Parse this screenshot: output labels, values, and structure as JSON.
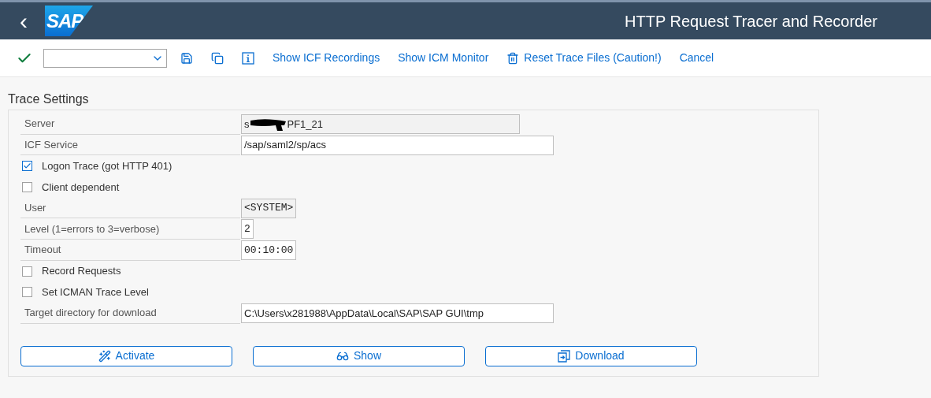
{
  "header": {
    "back": "‹",
    "logo": "SAP",
    "title": "HTTP Request Tracer and Recorder"
  },
  "toolbar": {
    "actions": [
      {
        "label": "Show ICF Recordings"
      },
      {
        "label": "Show ICM Monitor"
      },
      {
        "label": "Reset Trace Files (Caution!)"
      },
      {
        "label": "Cancel"
      }
    ]
  },
  "section": {
    "title": "Trace Settings",
    "rows": [
      {
        "kind": "field",
        "label": "Server",
        "value": "s",
        "value_after_redaction": "PF1_21",
        "readonly": true
      },
      {
        "kind": "field",
        "label": "ICF Service",
        "value": "/sap/saml2/sp/acs",
        "readonly": false
      },
      {
        "kind": "checkbox",
        "label": "Logon Trace (got HTTP 401)",
        "checked": true
      },
      {
        "kind": "checkbox",
        "label": "Client dependent",
        "checked": false
      },
      {
        "kind": "mono_field",
        "label": "User",
        "value": "<SYSTEM>",
        "readonly": true
      },
      {
        "kind": "mono_field",
        "label": "Level (1=errors to 3=verbose)",
        "value": "2",
        "readonly": false
      },
      {
        "kind": "mono_field",
        "label": "Timeout",
        "value": "00:10:00",
        "readonly": false
      },
      {
        "kind": "checkbox",
        "label": "Record Requests",
        "checked": false
      },
      {
        "kind": "checkbox",
        "label": "Set ICMAN Trace Level",
        "checked": false
      },
      {
        "kind": "field",
        "label": "Target directory for download",
        "value": "C:\\Users\\x281988\\AppData\\Local\\SAP\\SAP GUI\\tmp",
        "readonly": false
      }
    ],
    "buttons": [
      {
        "label": "Activate"
      },
      {
        "label": "Show"
      },
      {
        "label": "Download"
      }
    ]
  }
}
